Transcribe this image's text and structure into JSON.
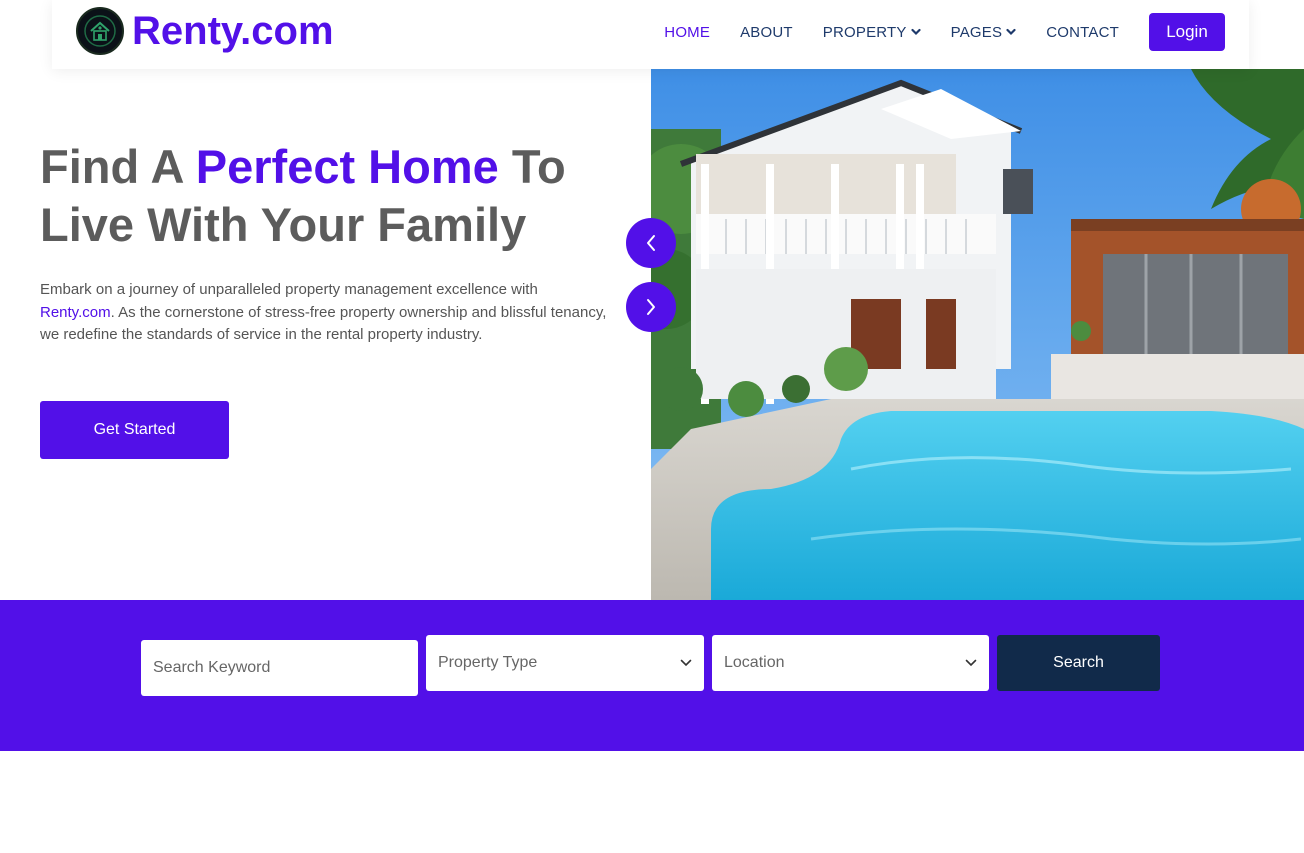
{
  "brand": {
    "name": "Renty.com",
    "logo_icon": "house-emblem-icon"
  },
  "nav": {
    "items": [
      {
        "label": "HOME",
        "active": true
      },
      {
        "label": "ABOUT",
        "active": false
      },
      {
        "label": "PROPERTY",
        "active": false,
        "dropdown": true
      },
      {
        "label": "PAGES",
        "active": false,
        "dropdown": true
      },
      {
        "label": "CONTACT",
        "active": false
      }
    ],
    "login_label": "Login"
  },
  "hero": {
    "title_part1": "Find A ",
    "title_accent": "Perfect Home",
    "title_part2": " To Live With Your Family",
    "text_before_link": "Embark on a journey of unparalleled property management excellence with ",
    "text_link": "Renty.com",
    "text_after_link": ". As the cornerstone of stress-free property ownership and blissful tenancy, we redefine the standards of service in the rental property industry.",
    "cta_label": "Get Started"
  },
  "slider": {
    "prev_icon": "chevron-left-icon",
    "next_icon": "chevron-right-icon"
  },
  "search": {
    "keyword_placeholder": "Search Keyword",
    "type_label": "Property Type",
    "location_label": "Location",
    "button_label": "Search"
  },
  "colors": {
    "accent": "#5210e8",
    "navy": "#112a4a",
    "nav_text": "#1e3a6b",
    "heading": "#5c5c5c"
  }
}
